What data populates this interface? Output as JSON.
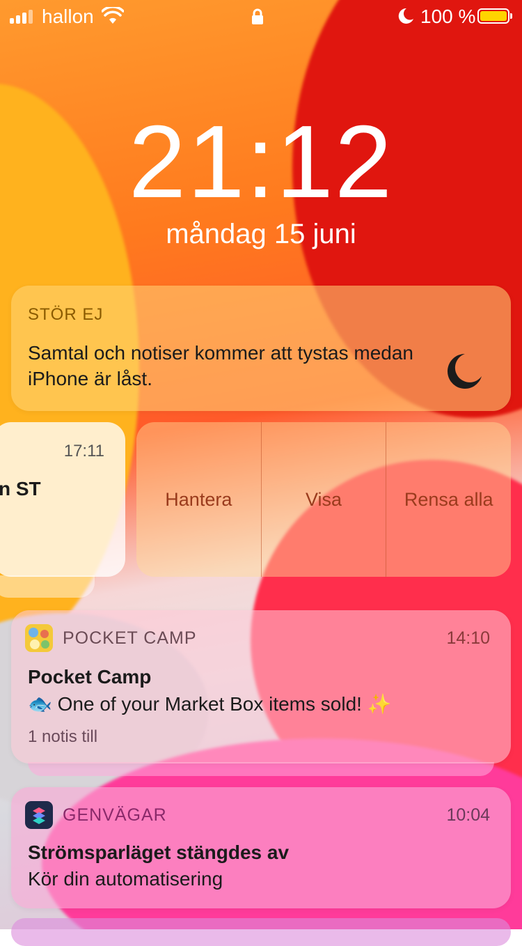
{
  "status_bar": {
    "carrier": "hallon",
    "battery_percent": "100 %",
    "icons": [
      "signal-icon",
      "wifi-icon",
      "lock-icon",
      "moon-icon",
      "battery-icon"
    ],
    "battery_fill_color": "#ffd400"
  },
  "lock_screen": {
    "time": "21:12",
    "date": "måndag 15 juni"
  },
  "do_not_disturb": {
    "header": "STÖR EJ",
    "message": "Samtal och notiser kommer att tystas medan iPhone är låst."
  },
  "swiped_notification": {
    "time": "17:11",
    "title_fragment": "n ST"
  },
  "swipe_actions": {
    "manage": "Hantera",
    "view": "Visa",
    "clear_all": "Rensa alla"
  },
  "notifications": [
    {
      "app": "POCKET CAMP",
      "time": "14:10",
      "title": "Pocket Camp",
      "message": "🐟 One of your Market Box items sold! ✨",
      "more": "1 notis till"
    },
    {
      "app": "GENVÄGAR",
      "time": "10:04",
      "title": "Strömsparläget stängdes av",
      "message": "Kör din automatisering"
    }
  ]
}
